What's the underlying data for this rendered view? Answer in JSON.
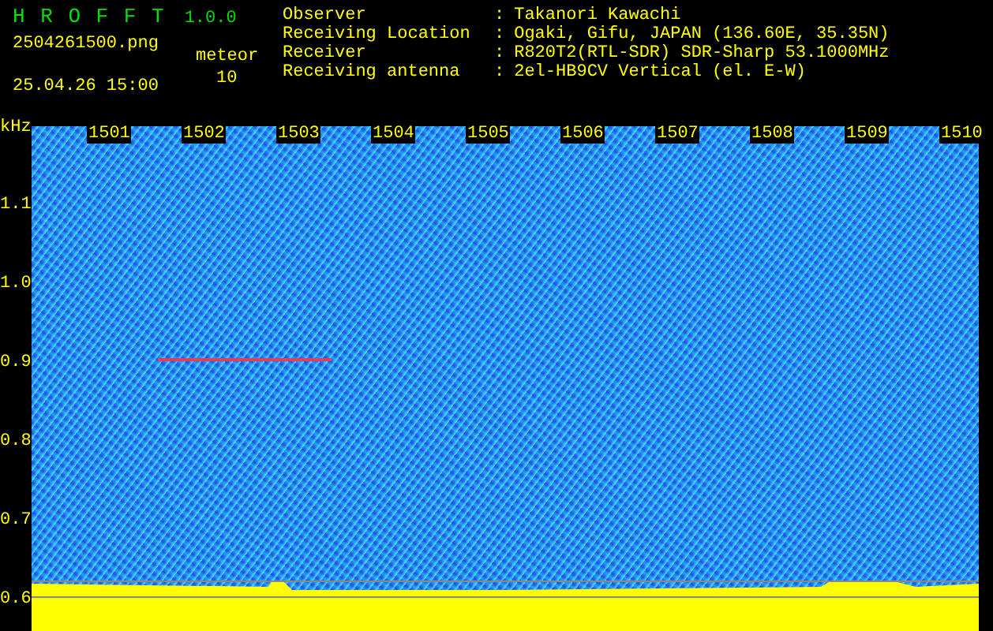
{
  "app": {
    "name": "H R O F F T",
    "version": "1.0.0"
  },
  "file": "2504261500.png",
  "datetime": "25.04.26 15:00",
  "meteor": {
    "label": "meteor",
    "count": "10"
  },
  "info": [
    {
      "label": "Observer",
      "separator": ":",
      "value": "Takanori Kawachi"
    },
    {
      "label": "Receiving Location",
      "separator": ":",
      "value": "Ogaki, Gifu, JAPAN (136.60E, 35.35N)"
    },
    {
      "label": "Receiver",
      "separator": ":",
      "value": "R820T2(RTL-SDR) SDR-Sharp 53.1000MHz"
    },
    {
      "label": "Receiving antenna",
      "separator": ":",
      "value": "2el-HB9CV Vertical (el. E-W)"
    }
  ],
  "plot": {
    "unit": "kHz",
    "time_labels": [
      "1501",
      "1502",
      "1503",
      "1504",
      "1505",
      "1506",
      "1507",
      "1508",
      "1509",
      "1510"
    ],
    "freq_labels": [
      "1.1",
      "1.0",
      "0.9",
      "0.8",
      "0.7",
      "0.6"
    ]
  }
}
